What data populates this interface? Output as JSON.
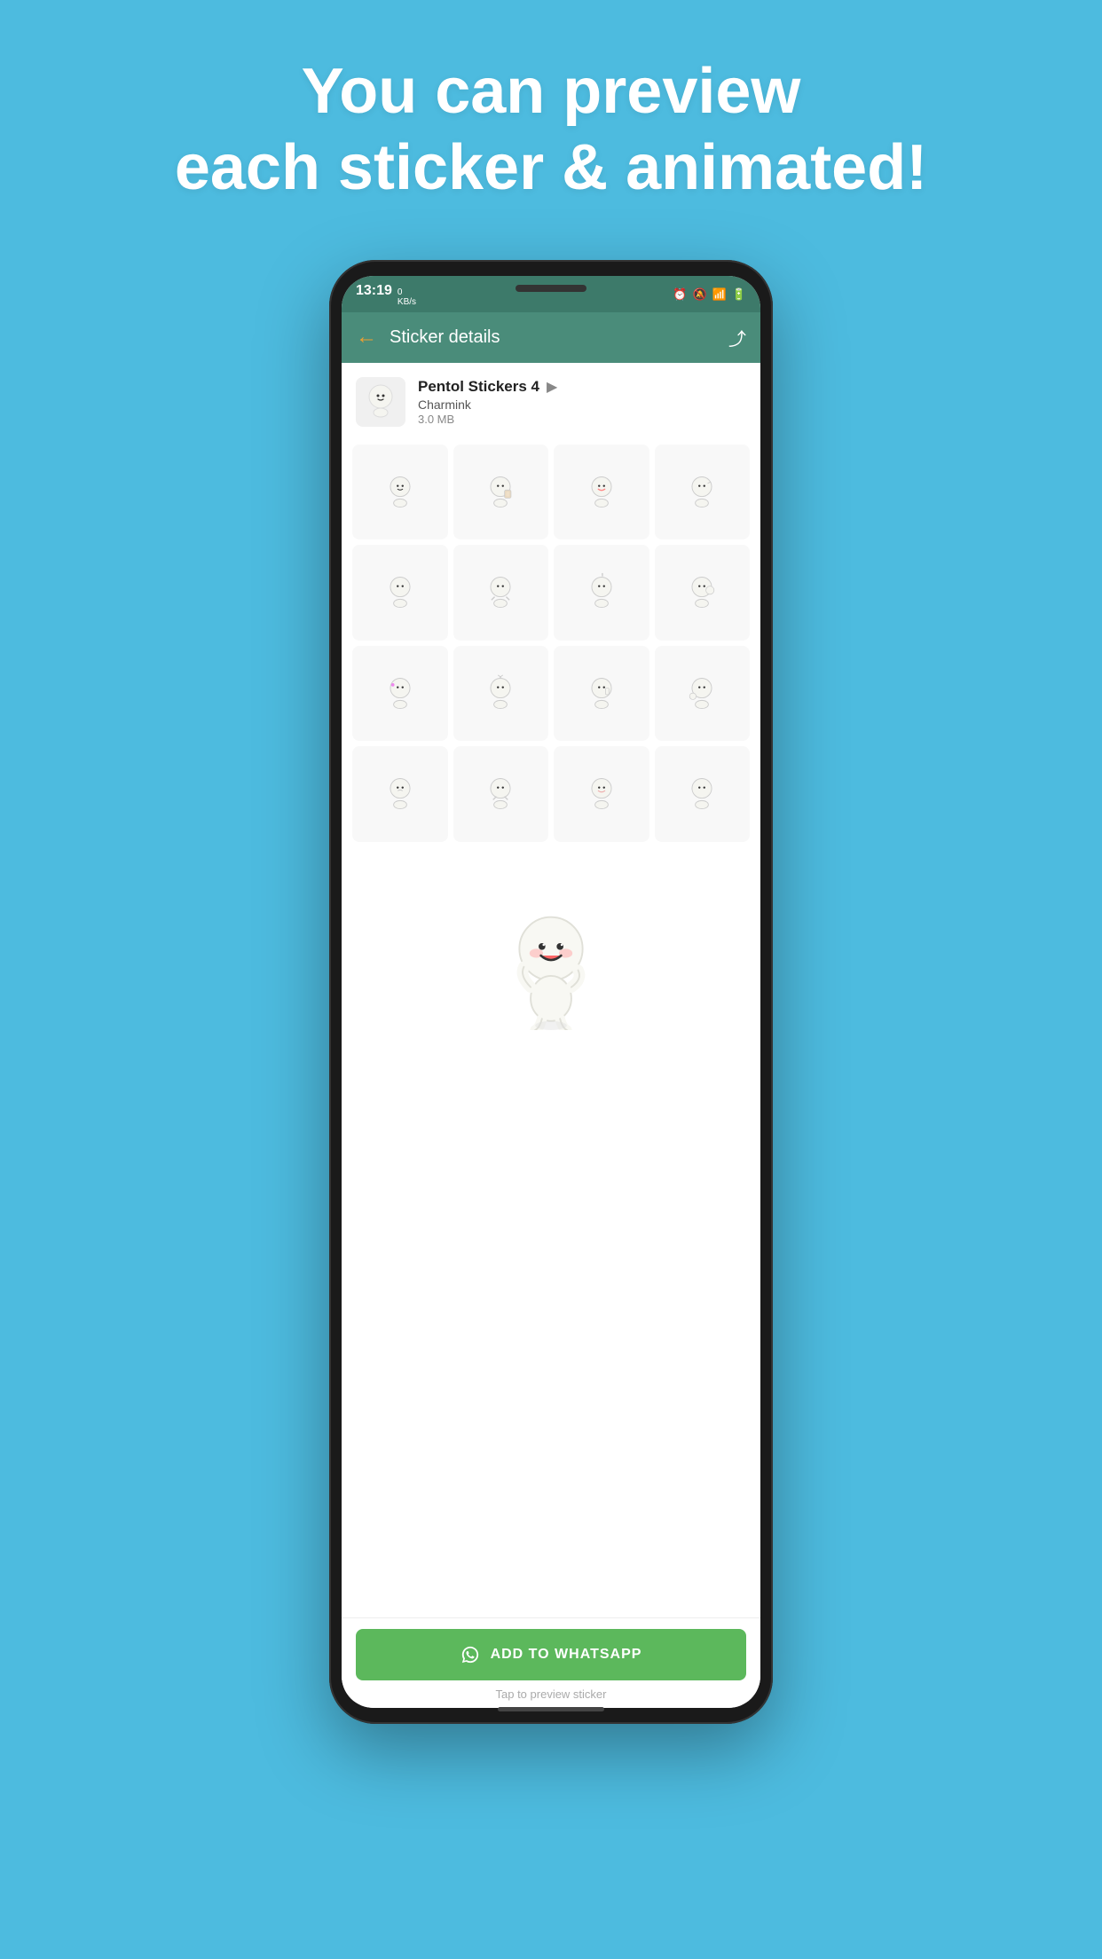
{
  "page": {
    "background_color": "#4DBBDF",
    "headline_line1": "You can preview",
    "headline_line2": "each sticker & animated!"
  },
  "status_bar": {
    "time": "13:19",
    "data_label": "0\nKB/s",
    "icons": [
      "alarm",
      "mute",
      "signal",
      "battery"
    ]
  },
  "app_bar": {
    "title": "Sticker details",
    "back_label": "←",
    "share_label": "⤴"
  },
  "pack": {
    "name": "Pentol Stickers 4",
    "author": "Charmink",
    "size": "3.0 MB",
    "play_icon": "▶"
  },
  "add_button": {
    "label": "ADD TO WHATSAPP"
  },
  "tap_preview": {
    "label": "Tap to preview sticker"
  }
}
